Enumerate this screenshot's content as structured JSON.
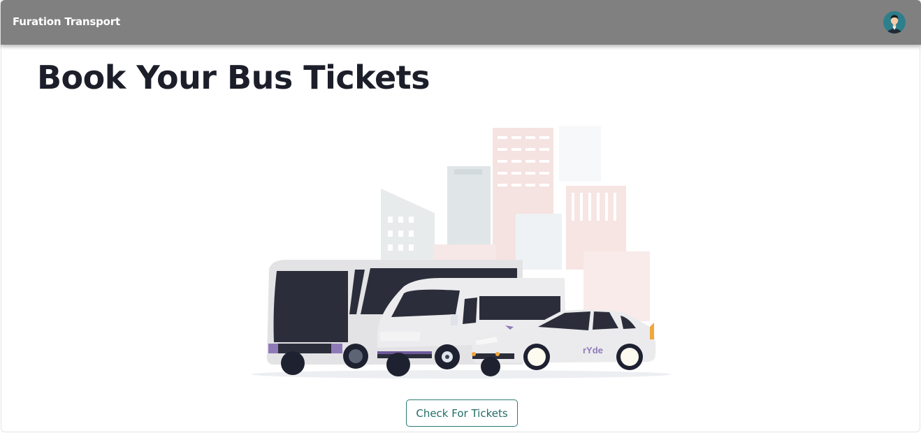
{
  "navbar": {
    "brand": "Furation Transport",
    "avatar_icon": "user-avatar-icon",
    "background_color": "#808080"
  },
  "hero": {
    "title": "Book Your Bus Tickets",
    "illustration_icon": "vehicles-city-illustration",
    "vehicle_brand_text": "rYde"
  },
  "actions": {
    "check_tickets_label": "Check For Tickets",
    "accent_color": "#2c7a74"
  }
}
